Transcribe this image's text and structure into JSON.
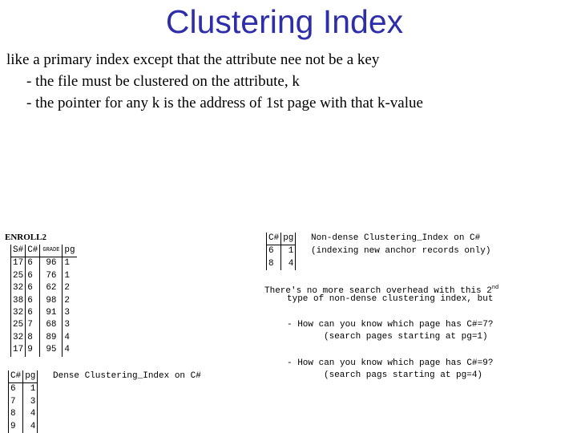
{
  "title": "Clustering Index",
  "intro": {
    "line1": "like a primary index except that the attribute nee not be a key",
    "bullet1": "- the file must be clustered on the attribute, k",
    "bullet2": "- the pointer for any k is the address of 1st page with that k-value"
  },
  "enroll": {
    "name": "ENROLL2",
    "headers": [
      "S#",
      "C#",
      "GRADE",
      "pg"
    ],
    "rows": [
      [
        "17",
        "6",
        "96",
        "1"
      ],
      [
        "25",
        "6",
        "76",
        "1"
      ],
      [
        "32",
        "6",
        "62",
        "2"
      ],
      [
        "38",
        "6",
        "98",
        "2"
      ],
      [
        "32",
        "6",
        "91",
        "3"
      ],
      [
        "25",
        "7",
        "68",
        "3"
      ],
      [
        "32",
        "8",
        "89",
        "4"
      ],
      [
        "17",
        "9",
        "95",
        "4"
      ]
    ]
  },
  "dense_index": {
    "caption": "Dense Clustering_Index on C#",
    "headers": [
      "C#",
      "pg"
    ],
    "rows": [
      [
        "6",
        "1"
      ],
      [
        "7",
        "3"
      ],
      [
        "8",
        "4"
      ],
      [
        "9",
        "4"
      ]
    ]
  },
  "nondense_index": {
    "caption1": "Non-dense Clustering_Index on C#",
    "caption2": "(indexing new anchor records only)",
    "headers": [
      "C#",
      "pg"
    ],
    "rows": [
      [
        "6",
        "1"
      ],
      [
        "8",
        "4"
      ]
    ]
  },
  "notes": {
    "line1": "There's no more search overhead with this 2",
    "line1_sup": "nd",
    "line2": "type of non-dense clustering index, but",
    "q1": "- How can you know which page has C#=7?",
    "a1": "(search pages starting at pg=1)",
    "q2": "- How can you know which page has C#=9?",
    "a2": "(search pags starting at pg=4)"
  }
}
